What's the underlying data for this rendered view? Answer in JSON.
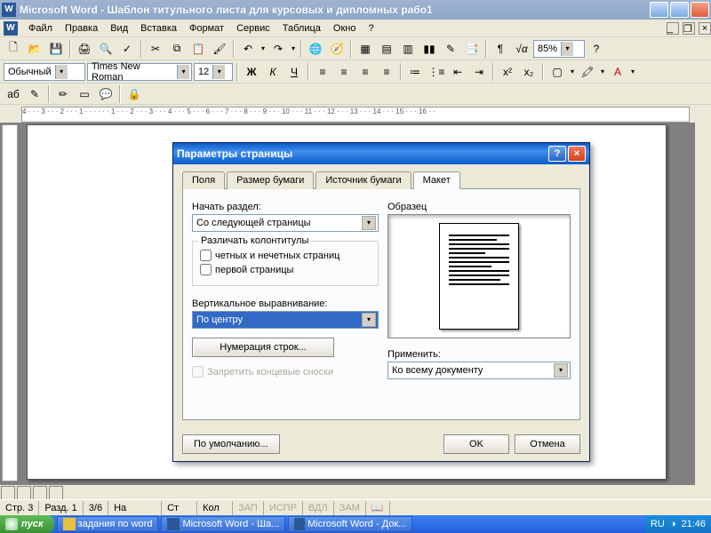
{
  "window": {
    "title": "Microsoft Word - Шаблон титульного листа для курсовых и дипломных рабо1"
  },
  "menu": {
    "items": [
      "Файл",
      "Правка",
      "Вид",
      "Вставка",
      "Формат",
      "Сервис",
      "Таблица",
      "Окно",
      "?"
    ]
  },
  "formatting": {
    "style": "Обычный",
    "font": "Times New Roman",
    "size": "12",
    "zoom": "85%"
  },
  "toolbar_labels": {
    "bold": "Ж",
    "italic": "К",
    "underline": "Ч",
    "small_a": "аб"
  },
  "ruler": "4 · · · 3 · · · 2 · · · 1 · · ·  · · · 1 · · · 2 · · · 3 · · · 4 · · · 5 · · · 6 · · · 7 · · · 8 · · · 9 · · · 10 · · · 11 · · · 12 · · · 13 · · · 14 · · · 15 · · · 16 · ·",
  "statusbar": {
    "page": "Стр. 3",
    "section": "Разд. 1",
    "pages": "3/6",
    "at": "На",
    "line": "Ст",
    "col": "Кол",
    "modes": [
      "ЗАП",
      "ИСПР",
      "ВДЛ",
      "ЗАМ"
    ]
  },
  "taskbar": {
    "start": "пуск",
    "items": [
      {
        "label": "задания по word",
        "type": "folder"
      },
      {
        "label": "Microsoft Word - Ша...",
        "type": "word"
      },
      {
        "label": "Microsoft Word - Док...",
        "type": "word"
      }
    ],
    "lang": "RU",
    "time": "21:46"
  },
  "dialog": {
    "title": "Параметры страницы",
    "tabs": [
      "Поля",
      "Размер бумаги",
      "Источник бумаги",
      "Макет"
    ],
    "active_tab": 3,
    "section_start_label": "Начать раздел:",
    "section_start_value": "Со следующей страницы",
    "headers_group": "Различать колонтитулы",
    "odd_even": "четных и нечетных страниц",
    "first_page": "первой страницы",
    "valign_label": "Вертикальное выравнивание:",
    "valign_value": "По центру",
    "line_numbers": "Нумерация строк...",
    "suppress_endnotes": "Запретить концевые сноски",
    "preview_label": "Образец",
    "apply_label": "Применить:",
    "apply_value": "Ко всему документу",
    "default_btn": "По умолчанию...",
    "ok": "OK",
    "cancel": "Отмена"
  }
}
